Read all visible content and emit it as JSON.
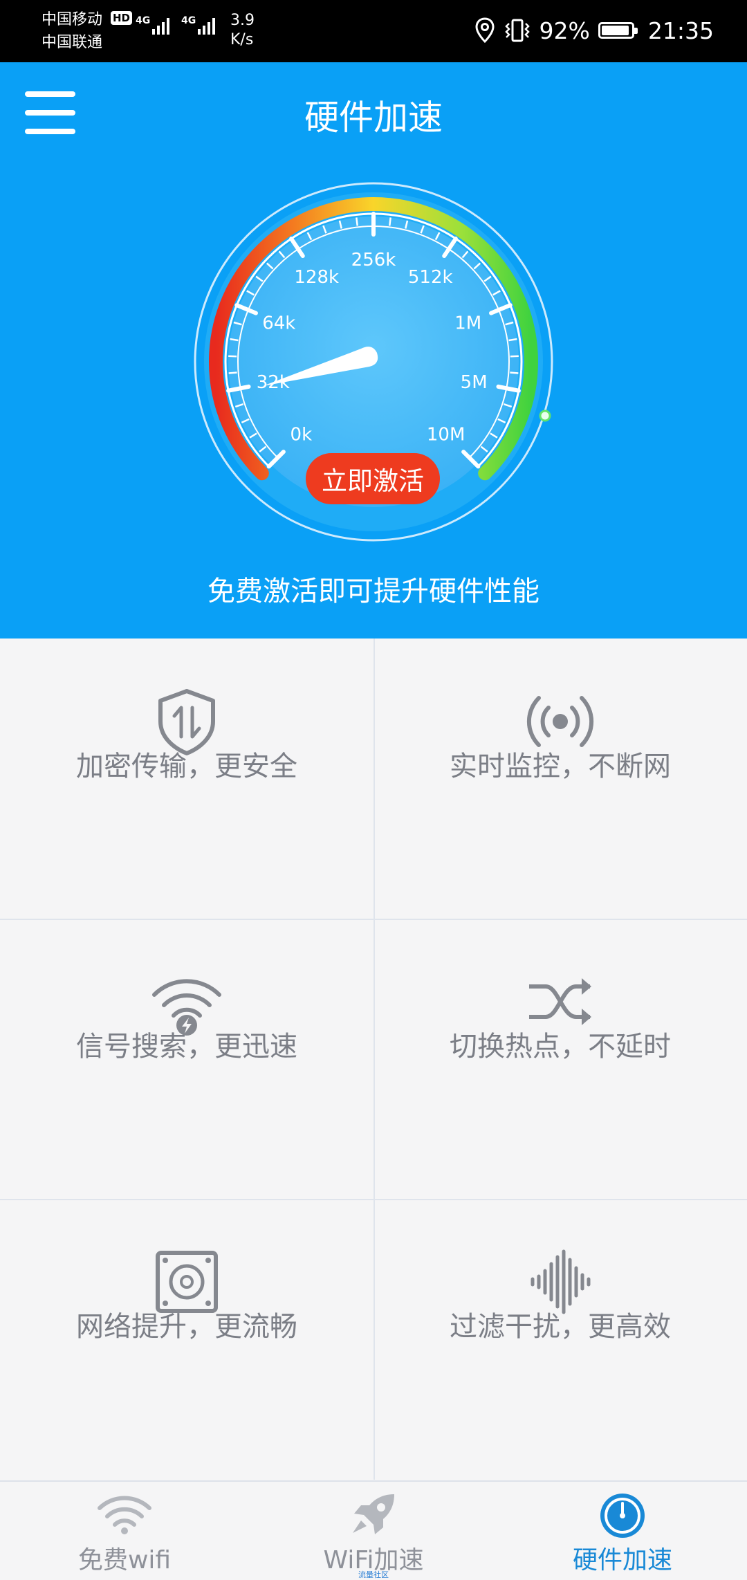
{
  "status_bar": {
    "carrier_1": "中国移动",
    "carrier_2": "中国联通",
    "hd_badge": "HD",
    "network_1": "4G",
    "network_2": "4G",
    "speed_value": "3.9",
    "speed_unit": "K/s",
    "battery_percent": "92%",
    "battery_level": 0.92,
    "time": "21:35"
  },
  "header": {
    "title": "硬件加速",
    "menu_icon": "hamburger-menu-icon"
  },
  "gauge": {
    "scale_labels": [
      "0k",
      "32k",
      "64k",
      "128k",
      "256k",
      "512k",
      "1M",
      "5M",
      "10M"
    ],
    "activate_label": "立即激活",
    "colors": {
      "red": "#e82a1e",
      "orange": "#f47c20",
      "yellow": "#f9d52a",
      "green": "#3fd23f"
    }
  },
  "hero": {
    "subtitle": "免费激活即可提升硬件性能"
  },
  "features": [
    {
      "label": "加密传输，更安全",
      "icon": "shield-transfer-icon"
    },
    {
      "label": "实时监控，不断网",
      "icon": "broadcast-icon"
    },
    {
      "label": "信号搜索，更迅速",
      "icon": "wifi-bolt-icon"
    },
    {
      "label": "切换热点，不延时",
      "icon": "shuffle-icon"
    },
    {
      "label": "网络提升，更流畅",
      "icon": "speaker-box-icon"
    },
    {
      "label": "过滤干扰，更高效",
      "icon": "sound-wave-icon"
    }
  ],
  "bottom_nav": {
    "items": [
      {
        "label": "免费wifi",
        "icon": "wifi-icon"
      },
      {
        "label": "WiFi加速",
        "icon": "rocket-icon",
        "sublabel": "流量社区"
      },
      {
        "label": "硬件加速",
        "icon": "speedometer-icon"
      }
    ],
    "active_index": 2
  }
}
